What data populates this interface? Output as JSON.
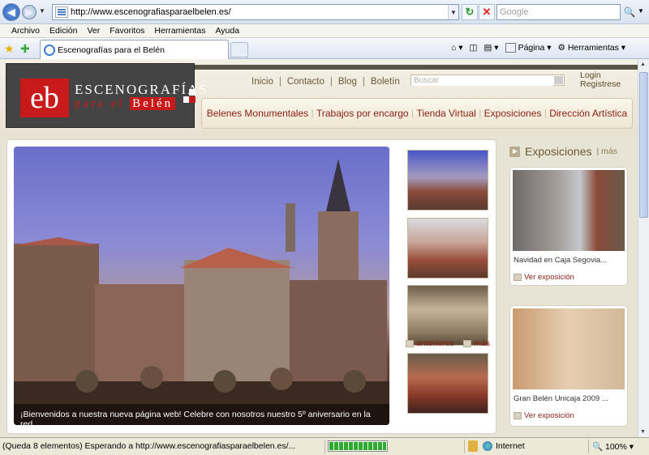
{
  "browser": {
    "url": "http://www.escenografiasparaelbelen.es/",
    "search_placeholder": "Google",
    "menu": [
      "Archivo",
      "Edición",
      "Ver",
      "Favoritos",
      "Herramientas",
      "Ayuda"
    ],
    "tab_title": "Escenografías para el Belén",
    "commands": {
      "page": "Página",
      "tools": "Herramientas"
    },
    "status_text": "(Queda 8 elementos) Esperando a http://www.escenografiasparaelbelen.es/...",
    "progress_percent": 100,
    "zone": "Internet",
    "zoom": "100%"
  },
  "site": {
    "logo": {
      "mark": "eb",
      "top": "ESCENOGRAFÍAS",
      "bottom_a": "para el",
      "bottom_b": "Belén"
    },
    "topnav": [
      "Inicio",
      "Contacto",
      "Blog",
      "Boletín"
    ],
    "search_placeholder": "Buscar",
    "login": "Login",
    "register": "Registrese",
    "mainnav": [
      "Belenes Monumentales",
      "Trabajos por encargo",
      "Tienda Virtual",
      "Exposiciones",
      "Dirección Artística"
    ],
    "hero_caption": "¡Bienvenidos a nuestra nueva página web! Celebre con nosotros nuestro 5º aniversario en la red.",
    "thumb_prev": "anteriores",
    "thumb_next": "más",
    "exhibitions": {
      "title": "Exposiciones",
      "more": "más",
      "items": [
        {
          "title": "Navidad en Caja Segovia...",
          "link": "Ver exposición"
        },
        {
          "title": "Gran Belén Unicaja 2009 ...",
          "link": "Ver exposición"
        }
      ]
    }
  }
}
